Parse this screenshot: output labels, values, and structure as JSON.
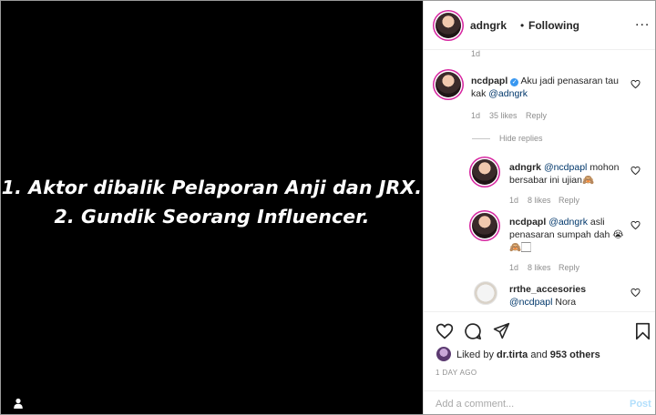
{
  "media": {
    "line1": "1. Aktor dibalik Pelaporan Anji dan JRX.",
    "line2": "2. Gundik Seorang Influencer."
  },
  "header": {
    "username": "adngrk",
    "dot": "•",
    "follow_label": "Following",
    "more": "..."
  },
  "comments": {
    "prev_time": "1d",
    "main": {
      "username": "ncdpapl",
      "text": "Aku jadi penasaran tau kak",
      "mention": "@adngrk",
      "time": "1d",
      "likes": "35 likes",
      "reply": "Reply"
    },
    "hide_replies": "Hide replies",
    "replies": [
      {
        "username": "adngrk",
        "mention": "@ncdpapl",
        "text": "mohon bersabar ini ujian🙈",
        "time": "1d",
        "likes": "8 likes",
        "reply": "Reply"
      },
      {
        "username": "ncdpapl",
        "mention": "@adngrk",
        "text": "asli penasaran sumpah dah 😭🙈🏻",
        "time": "1d",
        "likes": "8 likes",
        "reply": "Reply"
      },
      {
        "username": "rrthe_accesories",
        "mention": "@ncdpapl",
        "text": "Nora"
      }
    ]
  },
  "post": {
    "liked_by_prefix": "Liked by",
    "liker": "dr.tirta",
    "and": "and",
    "others": "953 others",
    "time": "1 DAY AGO",
    "add_comment_placeholder": "Add a comment...",
    "post_label": "Post"
  },
  "colors": {
    "mention": "#00376b",
    "verified": "#3897f0",
    "post_button": "#b2dffc"
  }
}
